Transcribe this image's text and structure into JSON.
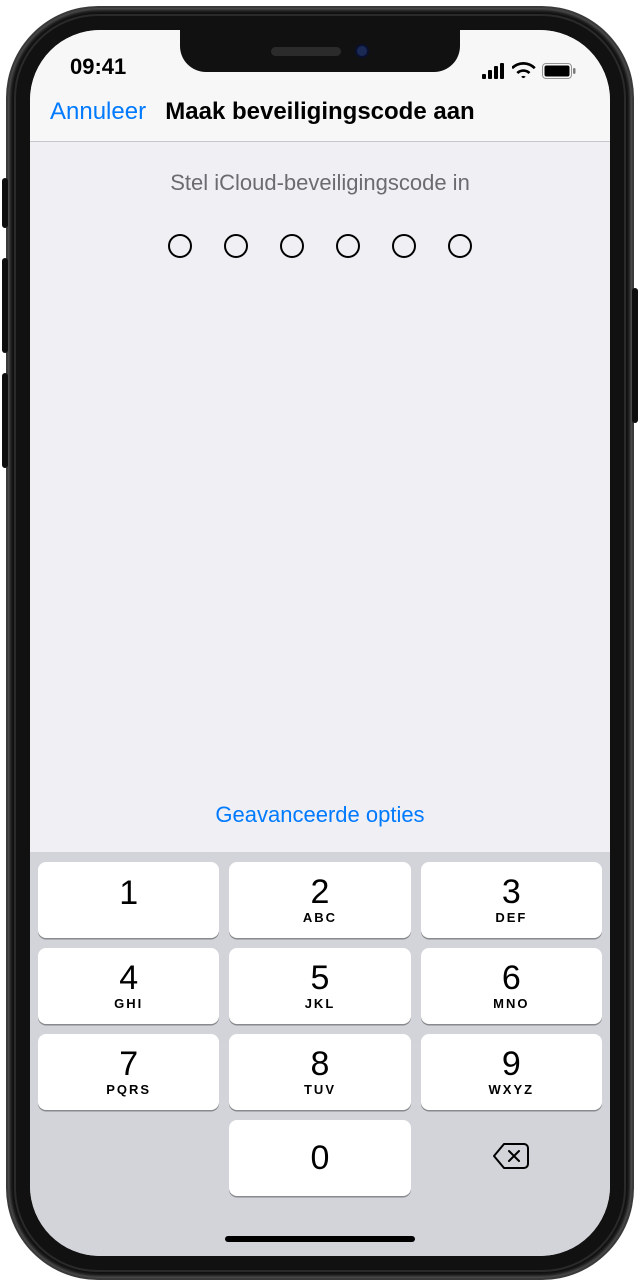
{
  "status": {
    "time": "09:41"
  },
  "nav": {
    "cancel": "Annuleer",
    "title": "Maak beveiligingscode aan"
  },
  "content": {
    "prompt": "Stel iCloud-beveiligingscode in",
    "advanced": "Geavanceerde opties",
    "code_length": 6
  },
  "keypad": {
    "keys": [
      {
        "digit": "1",
        "letters": ""
      },
      {
        "digit": "2",
        "letters": "ABC"
      },
      {
        "digit": "3",
        "letters": "DEF"
      },
      {
        "digit": "4",
        "letters": "GHI"
      },
      {
        "digit": "5",
        "letters": "JKL"
      },
      {
        "digit": "6",
        "letters": "MNO"
      },
      {
        "digit": "7",
        "letters": "PQRS"
      },
      {
        "digit": "8",
        "letters": "TUV"
      },
      {
        "digit": "9",
        "letters": "WXYZ"
      },
      {
        "digit": "0",
        "letters": ""
      }
    ]
  }
}
